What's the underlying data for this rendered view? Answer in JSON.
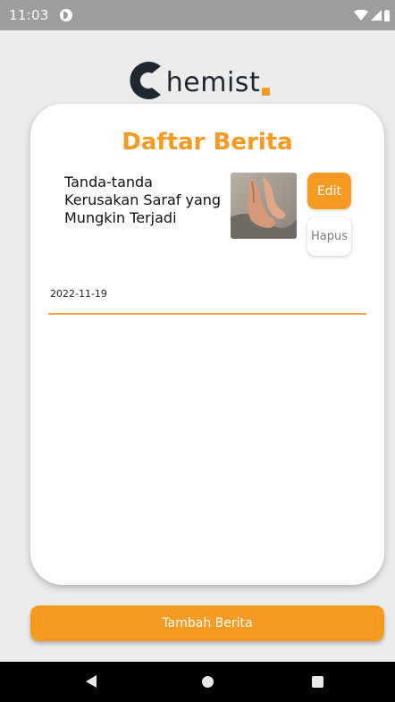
{
  "status_bar": {
    "time": "11:03",
    "icons": [
      "app-notification-icon",
      "wifi-icon",
      "signal-icon",
      "battery-icon"
    ]
  },
  "logo": {
    "text": "hemist",
    "colors": {
      "dark": "#1f2730",
      "accent": "#f79a21"
    }
  },
  "page": {
    "title": "Daftar Berita"
  },
  "news": [
    {
      "title": "Tanda-tanda Kerusakan Saraf yang Mungkin Terjadi",
      "date": "2022-11-19",
      "edit_label": "Edit",
      "delete_label": "Hapus"
    }
  ],
  "actions": {
    "add_label": "Tambah Berita"
  },
  "nav_bar": {
    "icons": [
      "back-icon",
      "home-icon",
      "recents-icon"
    ]
  },
  "theme": {
    "accent": "#f79a21",
    "background": "#ececec",
    "card": "#ffffff"
  }
}
